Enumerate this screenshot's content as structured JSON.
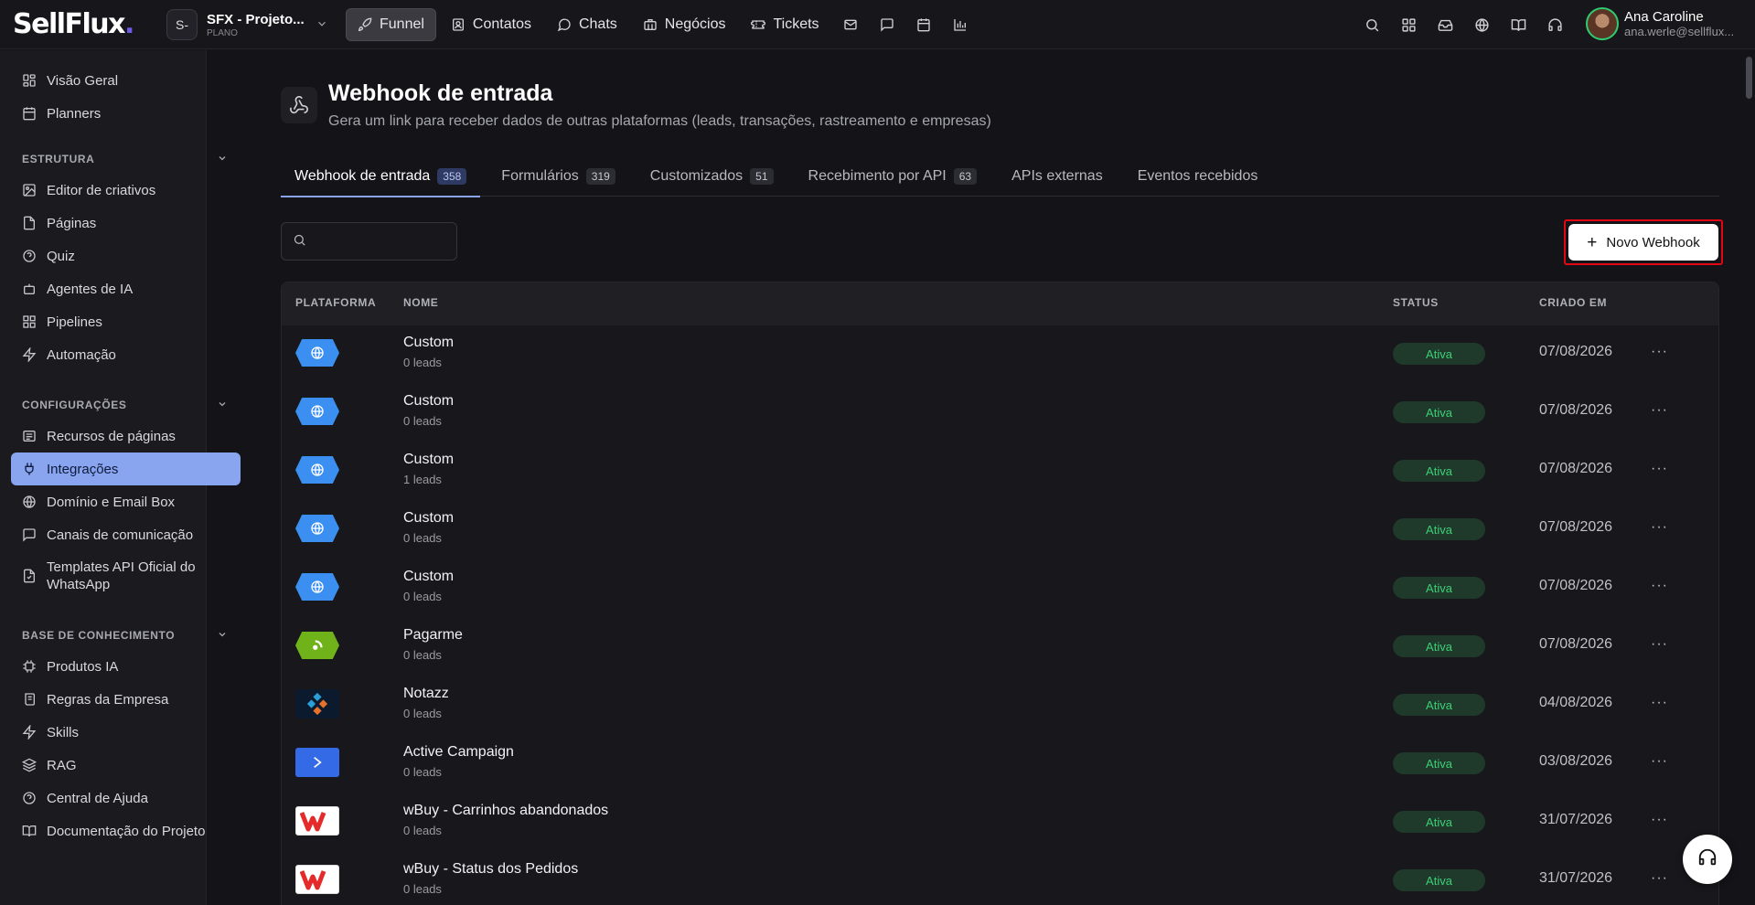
{
  "app": {
    "logo_text": "SellFlux",
    "logo_dot": "."
  },
  "project": {
    "avatar": "S-",
    "name": "SFX - Projeto...",
    "plan": "PLANO"
  },
  "nav": [
    {
      "label": "Funnel",
      "icon": "rocket-icon"
    },
    {
      "label": "Contatos",
      "icon": "contacts-icon"
    },
    {
      "label": "Chats",
      "icon": "chat-icon"
    },
    {
      "label": "Negócios",
      "icon": "briefcase-icon"
    },
    {
      "label": "Tickets",
      "icon": "ticket-icon"
    }
  ],
  "user": {
    "name": "Ana Caroline",
    "email": "ana.werle@sellflux..."
  },
  "sidebar": {
    "top": [
      {
        "label": "Visão Geral",
        "icon": "dashboard-icon"
      },
      {
        "label": "Planners",
        "icon": "calendar-icon"
      }
    ],
    "sections": [
      {
        "title": "ESTRUTURA",
        "items": [
          {
            "label": "Editor de criativos",
            "icon": "image-icon"
          },
          {
            "label": "Páginas",
            "icon": "file-icon"
          },
          {
            "label": "Quiz",
            "icon": "help-circle-icon"
          },
          {
            "label": "Agentes de IA",
            "icon": "bot-icon"
          },
          {
            "label": "Pipelines",
            "icon": "grid-icon"
          },
          {
            "label": "Automação",
            "icon": "lightning-icon"
          }
        ]
      },
      {
        "title": "CONFIGURAÇÕES",
        "items": [
          {
            "label": "Recursos de páginas",
            "icon": "list-icon"
          },
          {
            "label": "Integrações",
            "icon": "plug-icon"
          },
          {
            "label": "Domínio e Email Box",
            "icon": "globe-icon"
          },
          {
            "label": "Canais de comunicação",
            "icon": "message-icon"
          },
          {
            "label": "Templates API Oficial do WhatsApp",
            "icon": "template-icon"
          }
        ]
      },
      {
        "title": "BASE DE CONHECIMENTO",
        "items": [
          {
            "label": "Produtos IA",
            "icon": "chip-icon"
          },
          {
            "label": "Regras da Empresa",
            "icon": "scroll-icon"
          },
          {
            "label": "Skills",
            "icon": "lightning-icon"
          },
          {
            "label": "RAG",
            "icon": "layers-icon"
          },
          {
            "label": "Central de Ajuda",
            "icon": "help-circle-icon"
          },
          {
            "label": "Documentação do Projeto",
            "icon": "book-icon"
          }
        ]
      }
    ]
  },
  "page": {
    "title": "Webhook de entrada",
    "subtitle": "Gera um link para receber dados de outras plataformas (leads, transações, rastreamento e empresas)"
  },
  "tabs": [
    {
      "label": "Webhook de entrada",
      "count": "358"
    },
    {
      "label": "Formulários",
      "count": "319"
    },
    {
      "label": "Customizados",
      "count": "51"
    },
    {
      "label": "Recebimento por API",
      "count": "63"
    },
    {
      "label": "APIs externas",
      "count": ""
    },
    {
      "label": "Eventos recebidos",
      "count": ""
    }
  ],
  "search": {
    "placeholder": ""
  },
  "new_button": {
    "label": "Novo Webhook"
  },
  "table": {
    "headers": {
      "platform": "PLATAFORMA",
      "name": "NOME",
      "status": "STATUS",
      "created": "CRIADO EM"
    },
    "rows": [
      {
        "platform": "custom",
        "name": "Custom",
        "leads": "0 leads",
        "status": "Ativa",
        "date": "07/08/2026"
      },
      {
        "platform": "custom",
        "name": "Custom",
        "leads": "0 leads",
        "status": "Ativa",
        "date": "07/08/2026"
      },
      {
        "platform": "custom",
        "name": "Custom",
        "leads": "1 leads",
        "status": "Ativa",
        "date": "07/08/2026"
      },
      {
        "platform": "custom",
        "name": "Custom",
        "leads": "0 leads",
        "status": "Ativa",
        "date": "07/08/2026"
      },
      {
        "platform": "custom",
        "name": "Custom",
        "leads": "0 leads",
        "status": "Ativa",
        "date": "07/08/2026"
      },
      {
        "platform": "pagarme",
        "name": "Pagarme",
        "leads": "0 leads",
        "status": "Ativa",
        "date": "07/08/2026"
      },
      {
        "platform": "notazz",
        "name": "Notazz",
        "leads": "0 leads",
        "status": "Ativa",
        "date": "04/08/2026"
      },
      {
        "platform": "activecampaign",
        "name": "Active Campaign",
        "leads": "0 leads",
        "status": "Ativa",
        "date": "03/08/2026"
      },
      {
        "platform": "wbuy",
        "name": "wBuy - Carrinhos abandonados",
        "leads": "0 leads",
        "status": "Ativa",
        "date": "31/07/2026"
      },
      {
        "platform": "wbuy",
        "name": "wBuy - Status dos Pedidos",
        "leads": "0 leads",
        "status": "Ativa",
        "date": "31/07/2026"
      }
    ]
  },
  "colors": {
    "accent": "#8aa5f0",
    "status_green": "#3ecf75",
    "highlight_red": "#e30613"
  }
}
